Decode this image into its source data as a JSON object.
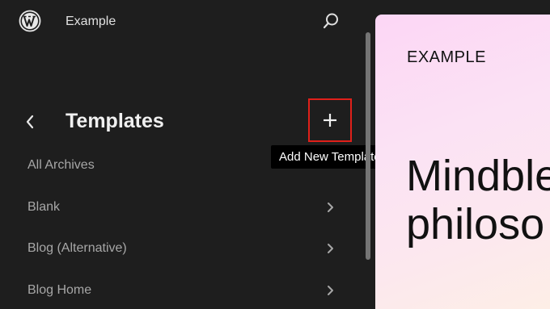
{
  "header": {
    "site_name": "Example",
    "logo_icon": "wordpress-logo-icon",
    "search_icon": "search-icon"
  },
  "section": {
    "title": "Templates",
    "back_icon": "chevron-left-icon",
    "add_icon": "plus-icon",
    "add_tooltip": "Add New Template"
  },
  "templates": [
    {
      "label": "All Archives",
      "chevron": false
    },
    {
      "label": "Blank",
      "chevron": true
    },
    {
      "label": "Blog (Alternative)",
      "chevron": true
    },
    {
      "label": "Blog Home",
      "chevron": true
    }
  ],
  "preview": {
    "site_title": "EXAMPLE",
    "heading_line1": "Mindble",
    "heading_line2": "philoso"
  },
  "colors": {
    "sidebar_bg": "#1e1e1e",
    "highlight_border": "#e0201a",
    "tooltip_bg": "#000000"
  }
}
